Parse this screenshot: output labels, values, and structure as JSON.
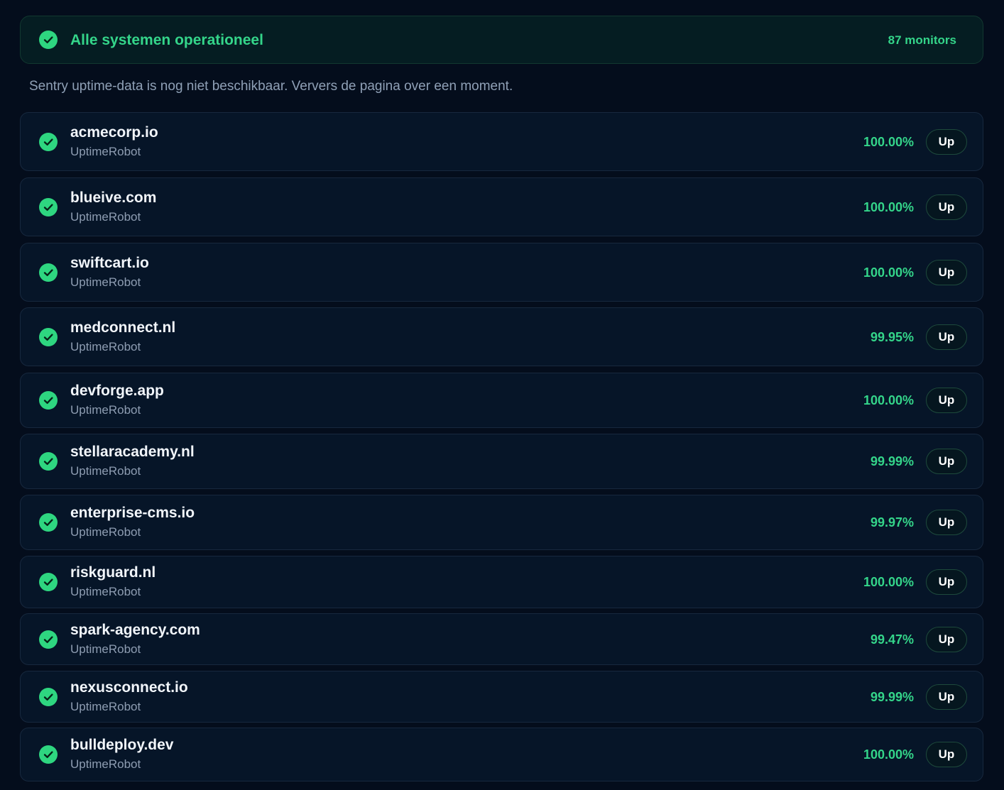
{
  "summary": {
    "title": "Alle systemen operationeel",
    "count_label": "87 monitors",
    "icon": "check-circle-icon",
    "status_color": "#34d58a"
  },
  "notice": "Sentry uptime-data is nog niet beschikbaar. Ververs de pagina over een moment.",
  "monitors": [
    {
      "name": "acmecorp.io",
      "source": "UptimeRobot",
      "uptime": "100.00%",
      "status": "Up"
    },
    {
      "name": "blueive.com",
      "source": "UptimeRobot",
      "uptime": "100.00%",
      "status": "Up"
    },
    {
      "name": "swiftcart.io",
      "source": "UptimeRobot",
      "uptime": "100.00%",
      "status": "Up"
    },
    {
      "name": "medconnect.nl",
      "source": "UptimeRobot",
      "uptime": "99.95%",
      "status": "Up"
    },
    {
      "name": "devforge.app",
      "source": "UptimeRobot",
      "uptime": "100.00%",
      "status": "Up"
    },
    {
      "name": "stellaracademy.nl",
      "source": "UptimeRobot",
      "uptime": "99.99%",
      "status": "Up"
    },
    {
      "name": "enterprise-cms.io",
      "source": "UptimeRobot",
      "uptime": "99.97%",
      "status": "Up"
    },
    {
      "name": "riskguard.nl",
      "source": "UptimeRobot",
      "uptime": "100.00%",
      "status": "Up"
    },
    {
      "name": "spark-agency.com",
      "source": "UptimeRobot",
      "uptime": "99.47%",
      "status": "Up"
    },
    {
      "name": "nexusconnect.io",
      "source": "UptimeRobot",
      "uptime": "99.99%",
      "status": "Up"
    },
    {
      "name": "bulldeploy.dev",
      "source": "UptimeRobot",
      "uptime": "100.00%",
      "status": "Up"
    }
  ]
}
